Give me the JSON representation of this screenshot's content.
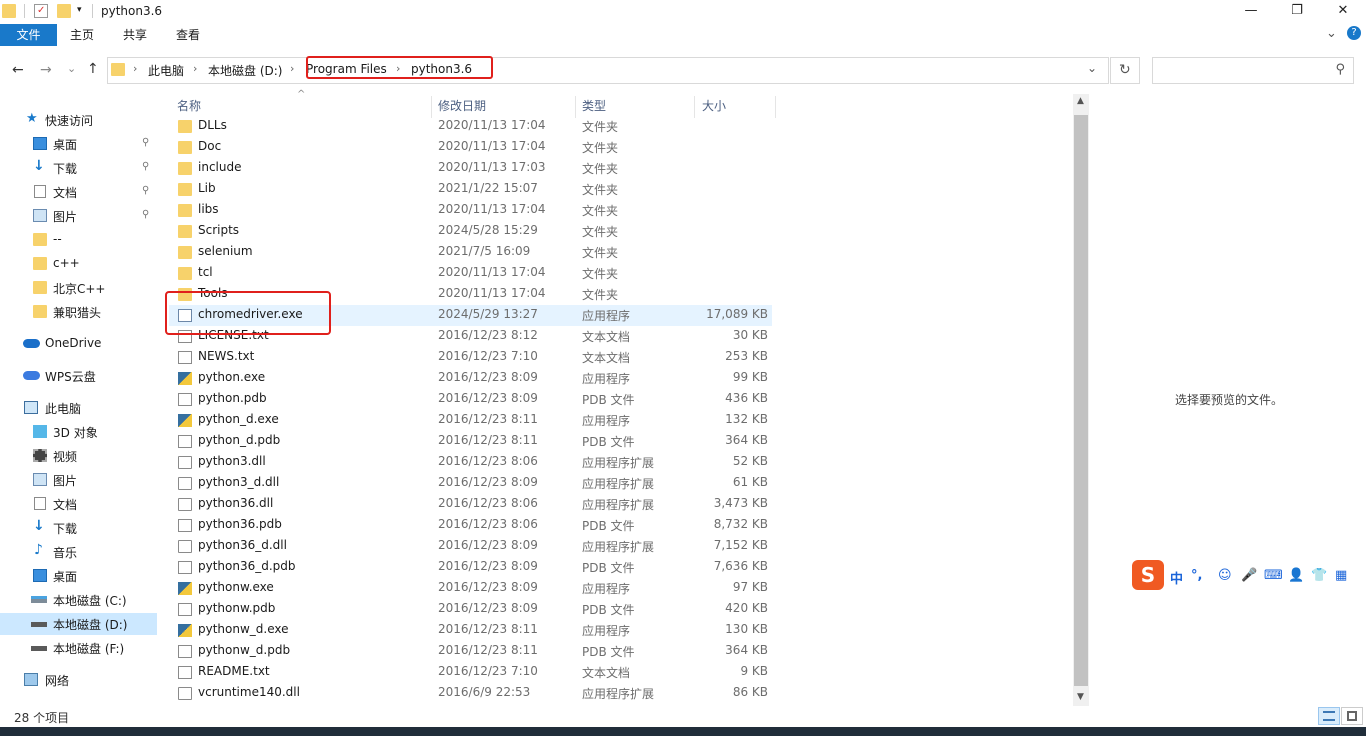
{
  "window": {
    "title": "python3.6",
    "minimize_glyph": "—",
    "maximize_glyph": "❐",
    "close_glyph": "✕"
  },
  "ribbon": {
    "tabs": [
      "文件",
      "主页",
      "共享",
      "查看"
    ],
    "collapse_glyph": "⌄",
    "help_glyph": "?"
  },
  "address": {
    "back_glyph": "←",
    "forward_glyph": "→",
    "recent_glyph": "⌄",
    "up_glyph": "↑",
    "crumbs": [
      "此电脑",
      "本地磁盘 (D:)",
      "Program Files",
      "python3.6"
    ],
    "separator": "›",
    "dropdown_glyph": "⌄",
    "refresh_glyph": "↻",
    "search_placeholder": "",
    "search_icon": "⚲"
  },
  "nav": {
    "quick_access": "快速访问",
    "pinned": [
      {
        "label": "桌面",
        "icon": "desktop-icon"
      },
      {
        "label": "下载",
        "icon": "download-icon"
      },
      {
        "label": "文档",
        "icon": "document-icon"
      },
      {
        "label": "图片",
        "icon": "picture-icon"
      }
    ],
    "recent_folders": [
      "--",
      "c++",
      "北京C++",
      "兼职猎头"
    ],
    "onedrive": "OneDrive",
    "wps": "WPS云盘",
    "this_pc": "此电脑",
    "pc_items": [
      {
        "label": "3D 对象",
        "icon": "3d-objects-icon"
      },
      {
        "label": "视频",
        "icon": "video-icon"
      },
      {
        "label": "图片",
        "icon": "picture-icon"
      },
      {
        "label": "文档",
        "icon": "document-icon"
      },
      {
        "label": "下载",
        "icon": "download-icon"
      },
      {
        "label": "音乐",
        "icon": "music-icon"
      },
      {
        "label": "桌面",
        "icon": "desktop-icon"
      },
      {
        "label": "本地磁盘 (C:)",
        "icon": "drive-icon"
      },
      {
        "label": "本地磁盘 (D:)",
        "icon": "drive-icon"
      },
      {
        "label": "本地磁盘 (F:)",
        "icon": "drive-icon"
      }
    ],
    "network": "网络",
    "pin_glyph": "📌"
  },
  "columns": {
    "name": "名称",
    "date": "修改日期",
    "type": "类型",
    "size": "大小",
    "sort_glyph": "^"
  },
  "files": [
    {
      "name": "DLLs",
      "date": "2020/11/13 17:04",
      "type": "文件夹",
      "size": "",
      "icon": "folder"
    },
    {
      "name": "Doc",
      "date": "2020/11/13 17:04",
      "type": "文件夹",
      "size": "",
      "icon": "folder"
    },
    {
      "name": "include",
      "date": "2020/11/13 17:03",
      "type": "文件夹",
      "size": "",
      "icon": "folder"
    },
    {
      "name": "Lib",
      "date": "2021/1/22 15:07",
      "type": "文件夹",
      "size": "",
      "icon": "folder"
    },
    {
      "name": "libs",
      "date": "2020/11/13 17:04",
      "type": "文件夹",
      "size": "",
      "icon": "folder"
    },
    {
      "name": "Scripts",
      "date": "2024/5/28 15:29",
      "type": "文件夹",
      "size": "",
      "icon": "folder"
    },
    {
      "name": "selenium",
      "date": "2021/7/5 16:09",
      "type": "文件夹",
      "size": "",
      "icon": "folder"
    },
    {
      "name": "tcl",
      "date": "2020/11/13 17:04",
      "type": "文件夹",
      "size": "",
      "icon": "folder"
    },
    {
      "name": "Tools",
      "date": "2020/11/13 17:04",
      "type": "文件夹",
      "size": "",
      "icon": "folder"
    },
    {
      "name": "chromedriver.exe",
      "date": "2024/5/29 13:27",
      "type": "应用程序",
      "size": "17,089 KB",
      "icon": "exe"
    },
    {
      "name": "LICENSE.txt",
      "date": "2016/12/23 8:12",
      "type": "文本文档",
      "size": "30 KB",
      "icon": "doc"
    },
    {
      "name": "NEWS.txt",
      "date": "2016/12/23 7:10",
      "type": "文本文档",
      "size": "253 KB",
      "icon": "doc"
    },
    {
      "name": "python.exe",
      "date": "2016/12/23 8:09",
      "type": "应用程序",
      "size": "99 KB",
      "icon": "py"
    },
    {
      "name": "python.pdb",
      "date": "2016/12/23 8:09",
      "type": "PDB 文件",
      "size": "436 KB",
      "icon": "doc"
    },
    {
      "name": "python_d.exe",
      "date": "2016/12/23 8:11",
      "type": "应用程序",
      "size": "132 KB",
      "icon": "py"
    },
    {
      "name": "python_d.pdb",
      "date": "2016/12/23 8:11",
      "type": "PDB 文件",
      "size": "364 KB",
      "icon": "doc"
    },
    {
      "name": "python3.dll",
      "date": "2016/12/23 8:06",
      "type": "应用程序扩展",
      "size": "52 KB",
      "icon": "dll"
    },
    {
      "name": "python3_d.dll",
      "date": "2016/12/23 8:09",
      "type": "应用程序扩展",
      "size": "61 KB",
      "icon": "dll"
    },
    {
      "name": "python36.dll",
      "date": "2016/12/23 8:06",
      "type": "应用程序扩展",
      "size": "3,473 KB",
      "icon": "dll"
    },
    {
      "name": "python36.pdb",
      "date": "2016/12/23 8:06",
      "type": "PDB 文件",
      "size": "8,732 KB",
      "icon": "doc"
    },
    {
      "name": "python36_d.dll",
      "date": "2016/12/23 8:09",
      "type": "应用程序扩展",
      "size": "7,152 KB",
      "icon": "dll"
    },
    {
      "name": "python36_d.pdb",
      "date": "2016/12/23 8:09",
      "type": "PDB 文件",
      "size": "7,636 KB",
      "icon": "doc"
    },
    {
      "name": "pythonw.exe",
      "date": "2016/12/23 8:09",
      "type": "应用程序",
      "size": "97 KB",
      "icon": "pyw"
    },
    {
      "name": "pythonw.pdb",
      "date": "2016/12/23 8:09",
      "type": "PDB 文件",
      "size": "420 KB",
      "icon": "doc"
    },
    {
      "name": "pythonw_d.exe",
      "date": "2016/12/23 8:11",
      "type": "应用程序",
      "size": "130 KB",
      "icon": "pyw"
    },
    {
      "name": "pythonw_d.pdb",
      "date": "2016/12/23 8:11",
      "type": "PDB 文件",
      "size": "364 KB",
      "icon": "doc"
    },
    {
      "name": "README.txt",
      "date": "2016/12/23 7:10",
      "type": "文本文档",
      "size": "9 KB",
      "icon": "doc"
    },
    {
      "name": "vcruntime140.dll",
      "date": "2016/6/9 22:53",
      "type": "应用程序扩展",
      "size": "86 KB",
      "icon": "dll"
    }
  ],
  "preview": {
    "message": "选择要预览的文件。"
  },
  "ime": {
    "logo": "S",
    "mode": "中",
    "punct": "°,",
    "items": [
      "☺",
      "🎤",
      "⌨",
      "👤",
      "👕",
      "▦"
    ]
  },
  "status": {
    "item_count": "28 个项目"
  },
  "colors": {
    "accent": "#1979ca",
    "highlight": "#e0201c",
    "folder": "#f7d26b",
    "selected_bg": "#cce8ff"
  }
}
